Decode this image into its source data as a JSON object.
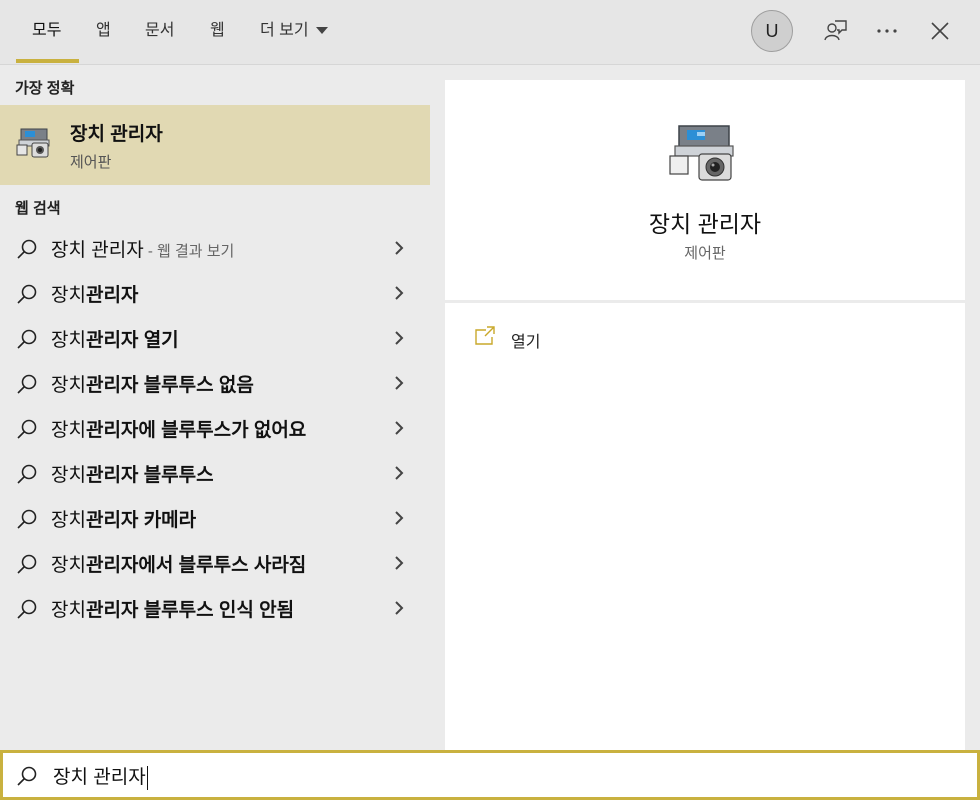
{
  "tabs": [
    {
      "label": "모두"
    },
    {
      "label": "앱"
    },
    {
      "label": "문서"
    },
    {
      "label": "웹"
    },
    {
      "label": "더 보기"
    }
  ],
  "user": {
    "avatar_initial": "U"
  },
  "icons": {
    "avatar": "user-avatar",
    "feedback": "feedback-icon",
    "more": "more-icon",
    "close": "close-icon",
    "search": "search-icon",
    "chevron": "chevron-right-icon",
    "device_manager": "device-manager-icon",
    "open": "open-icon"
  },
  "colors": {
    "accent": "#c9b13f",
    "best_match_bg": "#e1d9b3"
  },
  "best_match": {
    "header": "가장 정확",
    "title": "장치 관리자",
    "subtitle": "제어판"
  },
  "web_search": {
    "header": "웹 검색",
    "items": [
      {
        "prefix": "장치 관리자",
        "bold": "",
        "hint": " - 웹 결과 보기"
      },
      {
        "prefix": "장치",
        "bold": "관리자",
        "hint": ""
      },
      {
        "prefix": "장치",
        "bold": "관리자 열기",
        "hint": ""
      },
      {
        "prefix": "장치",
        "bold": "관리자 블루투스 없음",
        "hint": ""
      },
      {
        "prefix": "장치",
        "bold": "관리자에 블루투스가 없어요",
        "hint": ""
      },
      {
        "prefix": "장치",
        "bold": "관리자 블루투스",
        "hint": ""
      },
      {
        "prefix": "장치",
        "bold": "관리자 카메라",
        "hint": ""
      },
      {
        "prefix": "장치",
        "bold": "관리자에서 블루투스 사라짐",
        "hint": ""
      },
      {
        "prefix": "장치",
        "bold": "관리자 블루투스 인식 안됨",
        "hint": ""
      }
    ]
  },
  "preview": {
    "title": "장치 관리자",
    "subtitle": "제어판",
    "actions": [
      {
        "label": "열기"
      }
    ]
  },
  "search": {
    "value": "장치 관리자"
  }
}
